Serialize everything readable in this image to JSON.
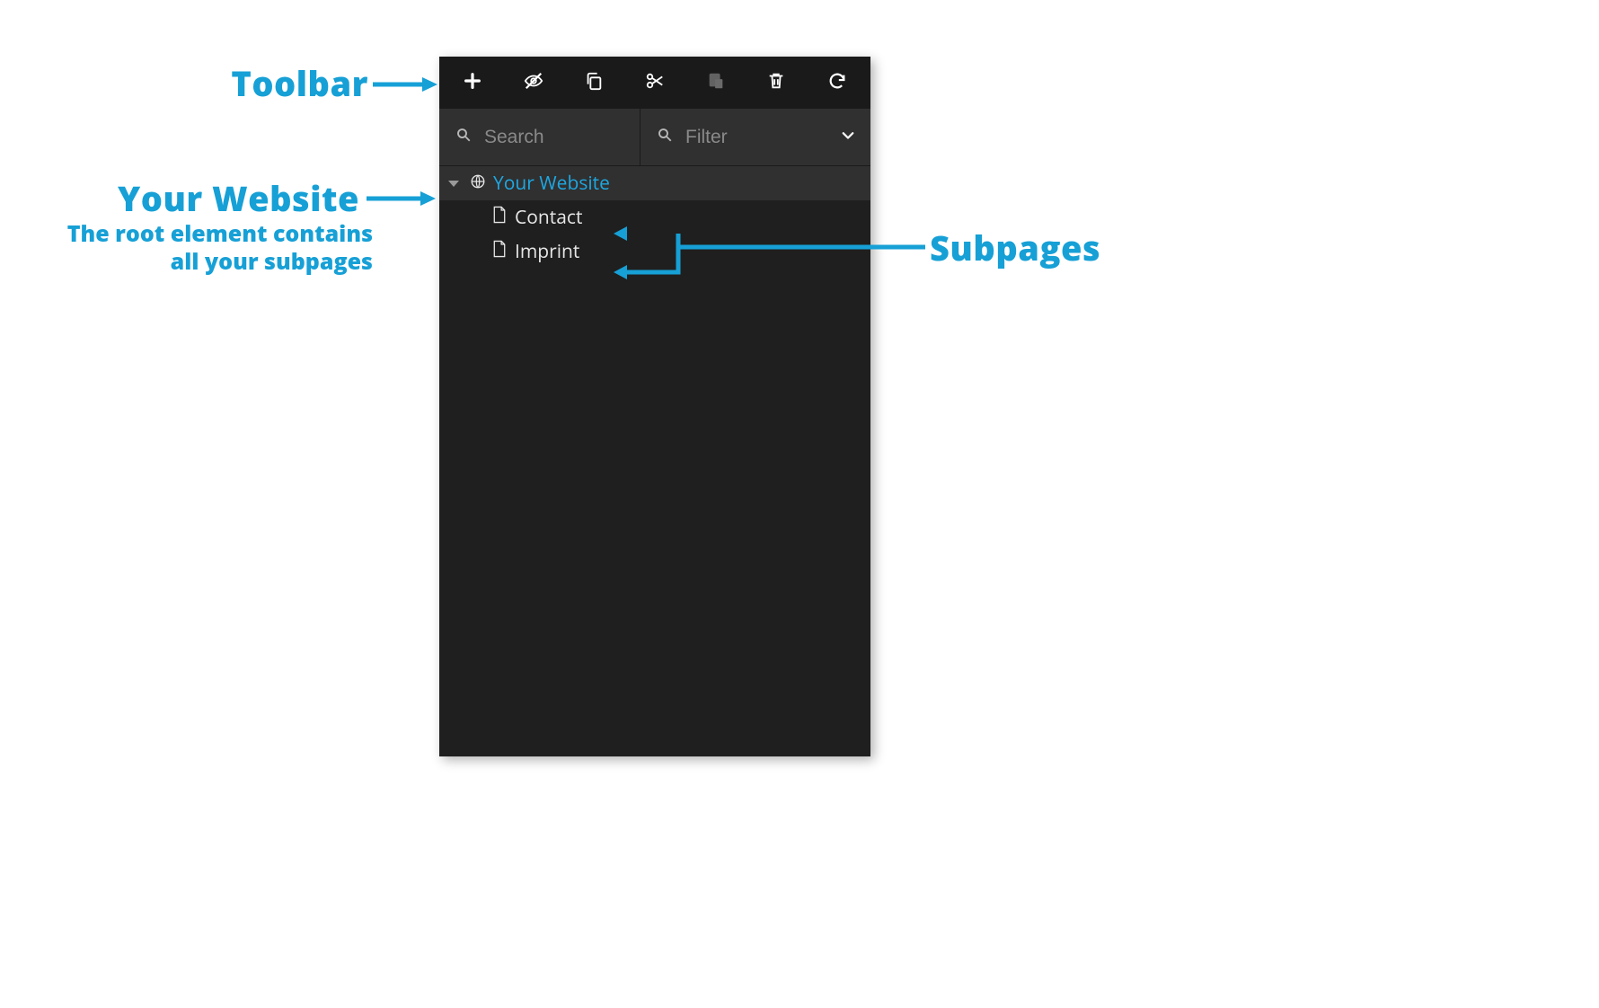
{
  "annotations": {
    "toolbar_label": "Toolbar",
    "website_label": "Your Website",
    "website_sub": "The root element contains all your subpages",
    "subpages_label": "Subpages"
  },
  "toolbar": {
    "items": [
      {
        "name": "add",
        "disabled": false
      },
      {
        "name": "hide",
        "disabled": false
      },
      {
        "name": "copy",
        "disabled": false
      },
      {
        "name": "cut",
        "disabled": false
      },
      {
        "name": "paste",
        "disabled": true
      },
      {
        "name": "delete",
        "disabled": false
      },
      {
        "name": "refresh",
        "disabled": false
      }
    ]
  },
  "search": {
    "placeholder": "Search",
    "value": ""
  },
  "filter": {
    "placeholder": "Filter",
    "value": ""
  },
  "tree": {
    "root_label": "Your Website",
    "children": [
      {
        "label": "Contact"
      },
      {
        "label": "Imprint"
      }
    ]
  }
}
